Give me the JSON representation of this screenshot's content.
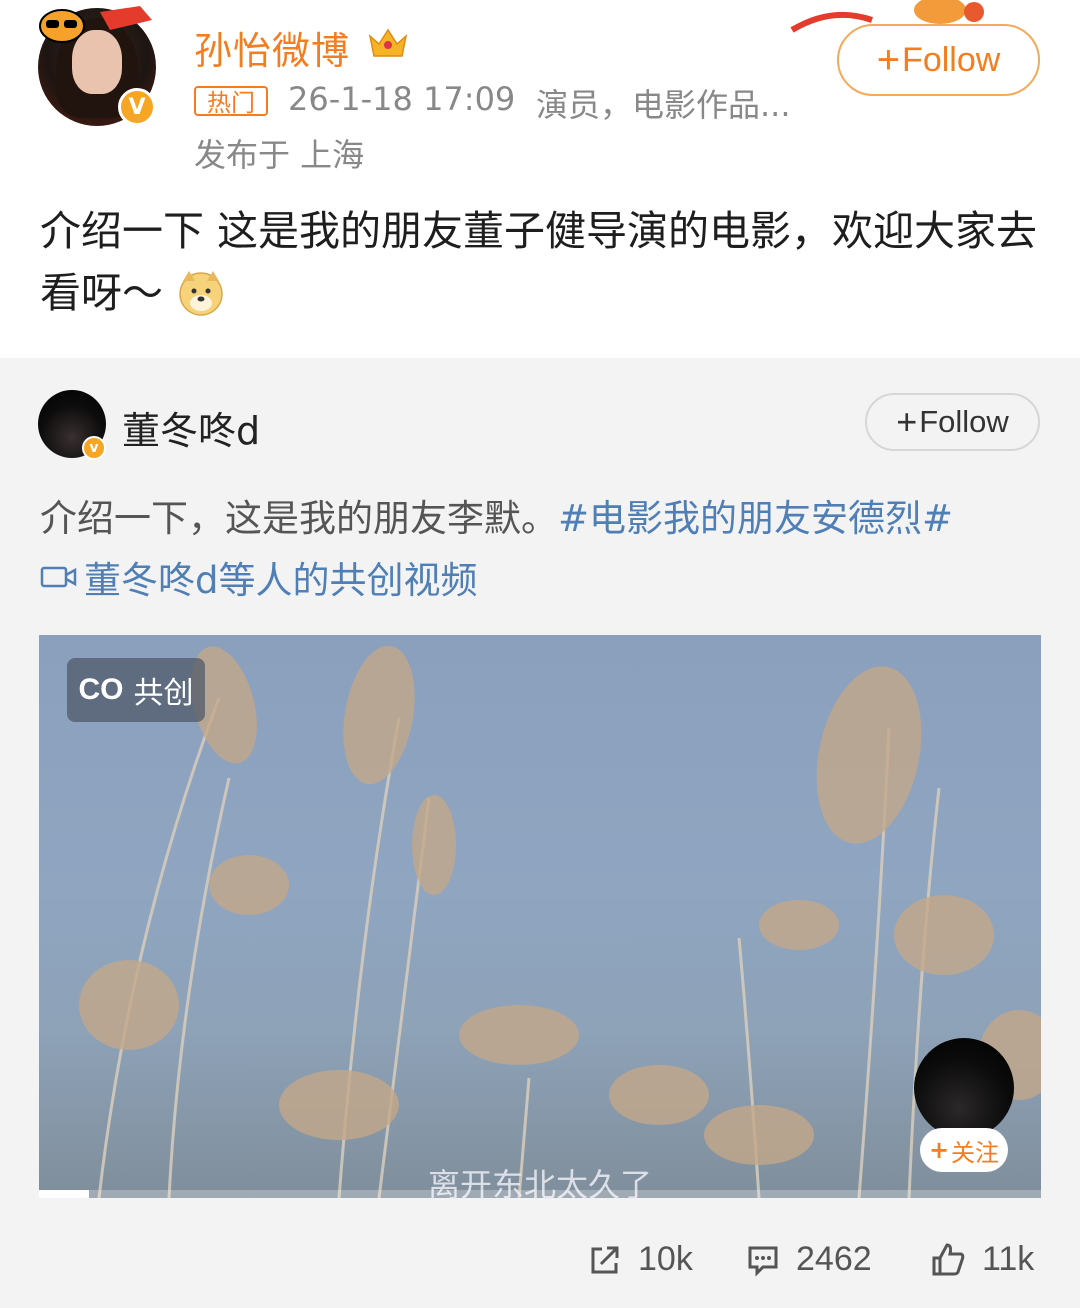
{
  "post": {
    "author": "孙怡微博",
    "hot_label": "热门",
    "timestamp": "26-1-18 17:09",
    "tags": "演员，电影作品...",
    "location": "发布于 上海",
    "follow_label": "Follow",
    "text": "介绍一下 这是我的朋友董子健导演的电影，欢迎大家去看呀～"
  },
  "repost": {
    "author": "董冬咚d",
    "follow_label": "Follow",
    "text": "介绍一下，这是我的朋友李默。",
    "hashtag": "#电影我的朋友安德烈#",
    "cocreate_link": "董冬咚d等人的共创视频"
  },
  "video": {
    "cocreate_badge": "共创",
    "cocreate_prefix": "CO",
    "subtitle": "离开东北太久了",
    "overlay_follow": "关注",
    "progress": 0.05
  },
  "actions": {
    "share_count": "10k",
    "comment_count": "2462",
    "like_count": "11k"
  },
  "colors": {
    "brand_orange": "#f57d1f",
    "link_blue": "#4f7fb5",
    "repost_bg": "#f3f3f3"
  },
  "icons": [
    "crown-icon",
    "verified-icon",
    "doge-emoji-icon",
    "video-camera-icon",
    "share-icon",
    "comment-icon",
    "like-icon",
    "plus-icon"
  ]
}
